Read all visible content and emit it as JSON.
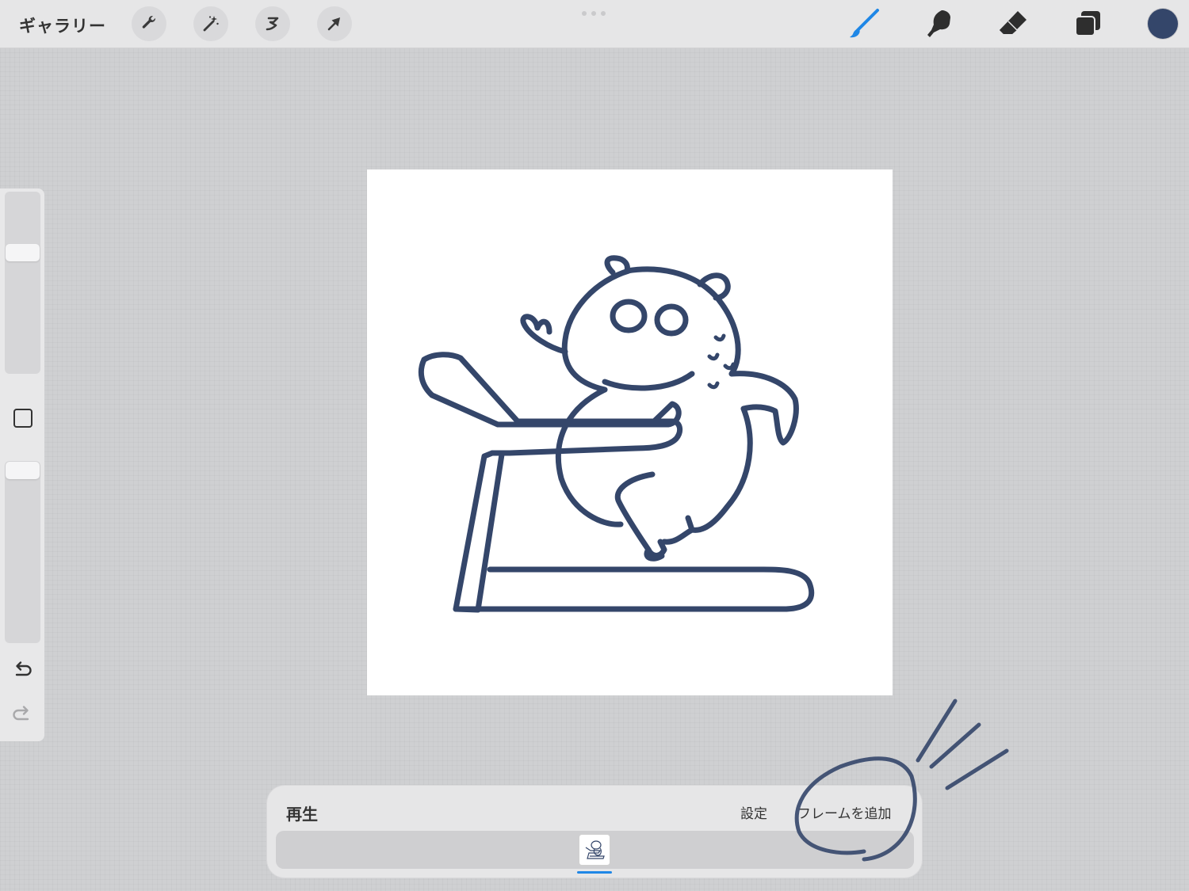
{
  "toolbar": {
    "gallery_label": "ギャラリー",
    "left_tools": [
      {
        "name": "actions",
        "icon": "wrench-icon"
      },
      {
        "name": "adjustments",
        "icon": "magic-wand-icon"
      },
      {
        "name": "selection",
        "icon": "selection-s-icon"
      },
      {
        "name": "transform",
        "icon": "arrow-icon"
      }
    ],
    "right_tools": [
      {
        "name": "brush",
        "icon": "brush-icon",
        "active": true
      },
      {
        "name": "smudge",
        "icon": "smudge-finger-icon"
      },
      {
        "name": "eraser",
        "icon": "eraser-icon"
      },
      {
        "name": "layers",
        "icon": "layers-icon"
      }
    ],
    "active_tool_color": "#1f87e6",
    "current_color": "#34466a"
  },
  "sidebar": {
    "brush_size": 0.7,
    "opacity": 1.0,
    "undo_icon": "undo-icon",
    "redo_icon": "redo-icon"
  },
  "animation": {
    "play_label": "再生",
    "settings_label": "設定",
    "add_frame_label": "フレームを追加",
    "frames": 1,
    "selected_frame": 1
  },
  "stroke_color": "#34466a"
}
